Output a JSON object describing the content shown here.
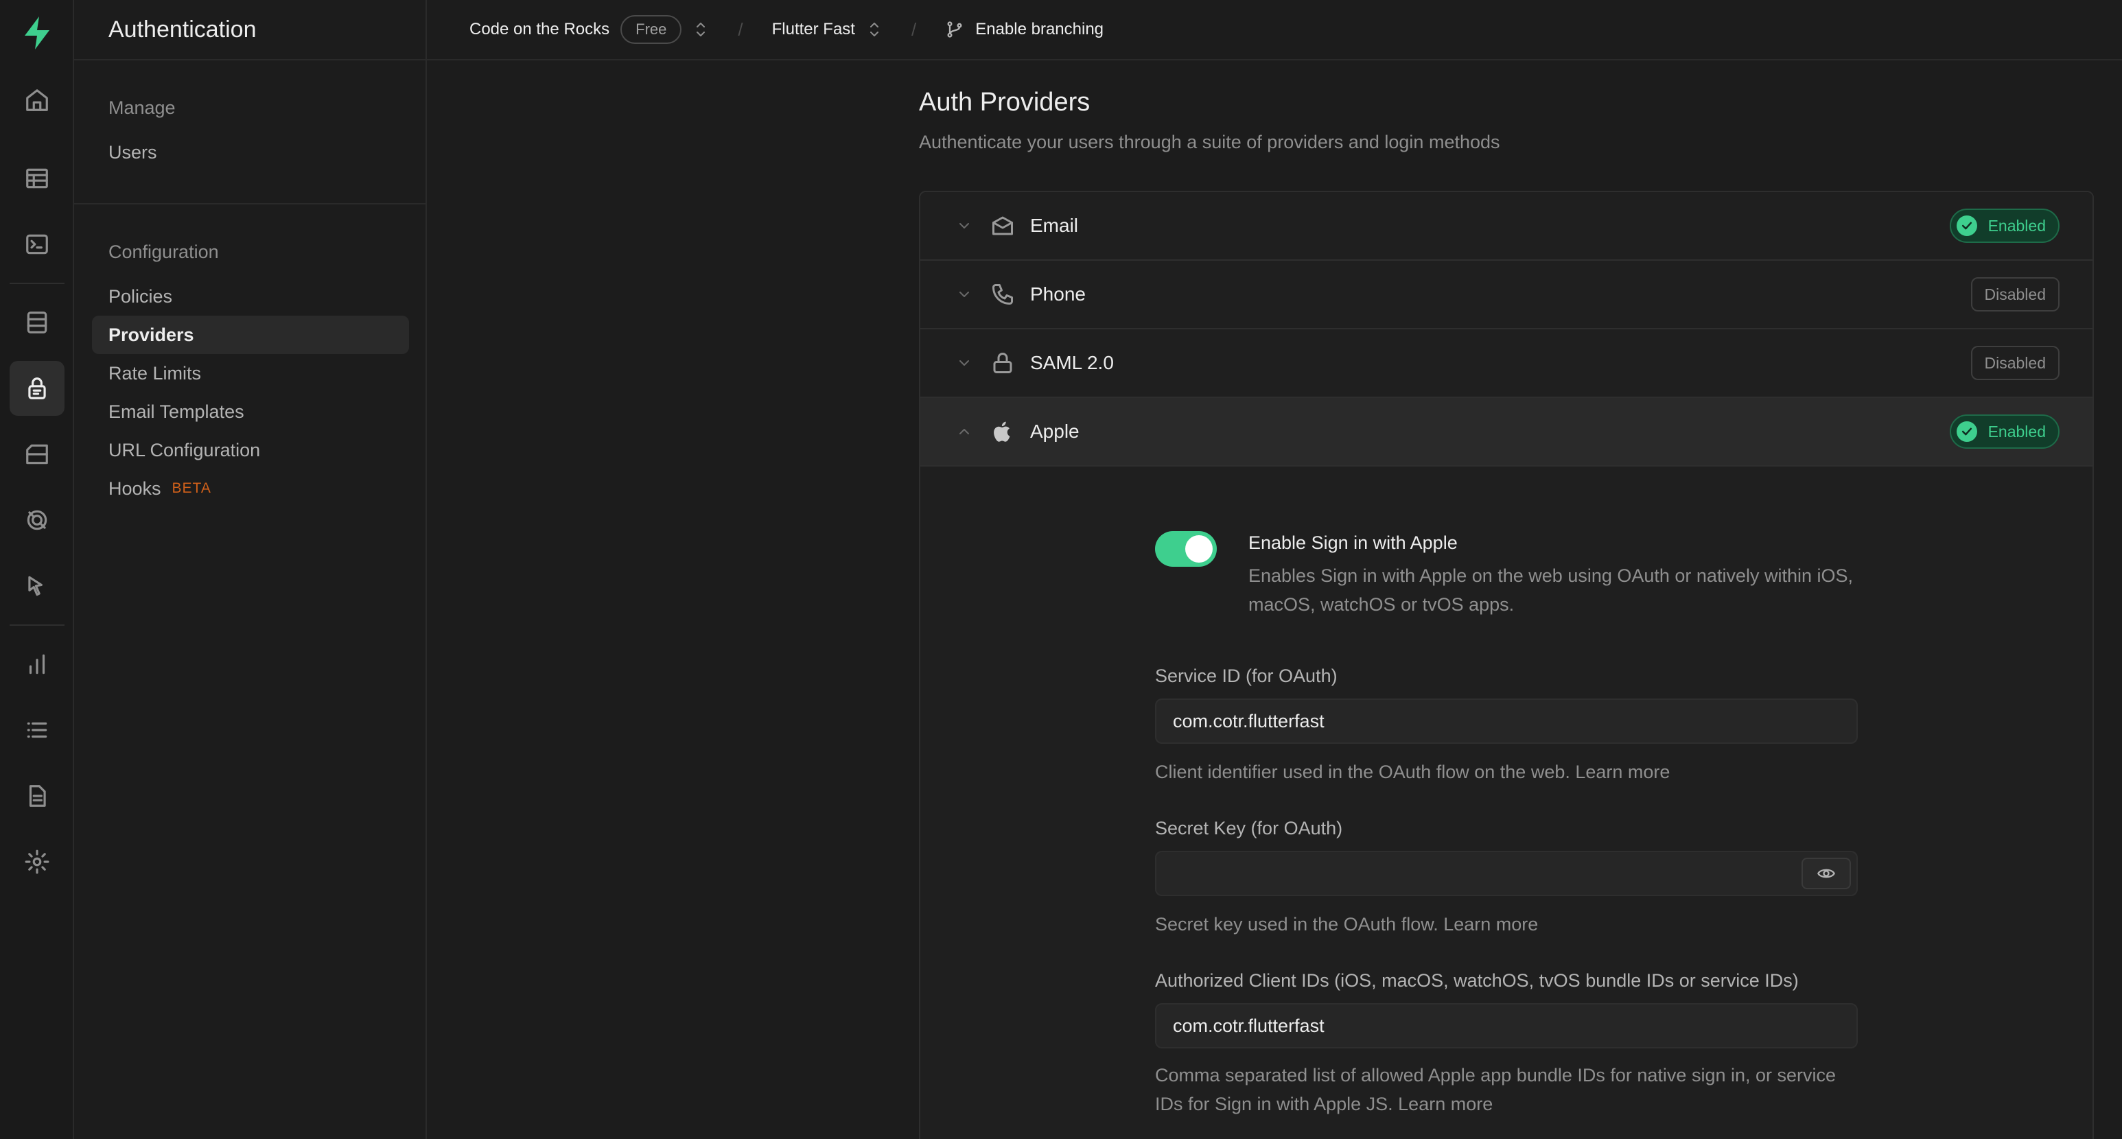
{
  "sidebar": {
    "title": "Authentication",
    "groups": [
      {
        "title": "Manage",
        "items": [
          {
            "label": "Users"
          }
        ]
      },
      {
        "title": "Configuration",
        "items": [
          {
            "label": "Policies"
          },
          {
            "label": "Providers"
          },
          {
            "label": "Rate Limits"
          },
          {
            "label": "Email Templates"
          },
          {
            "label": "URL Configuration"
          },
          {
            "label": "Hooks",
            "badge": "BETA"
          }
        ]
      }
    ]
  },
  "topbar": {
    "org": "Code on the Rocks",
    "plan": "Free",
    "project": "Flutter Fast",
    "branching": "Enable branching"
  },
  "page": {
    "title": "Auth Providers",
    "subtitle": "Authenticate your users through a suite of providers and login methods"
  },
  "providers": [
    {
      "name": "Email",
      "status": "Enabled",
      "icon": "envelope-icon"
    },
    {
      "name": "Phone",
      "status": "Disabled",
      "icon": "phone-icon"
    },
    {
      "name": "SAML 2.0",
      "status": "Disabled",
      "icon": "lock-icon"
    },
    {
      "name": "Apple",
      "status": "Enabled",
      "icon": "apple-icon"
    }
  ],
  "apple": {
    "enable_title": "Enable Sign in with Apple",
    "enable_desc": "Enables Sign in with Apple on the web using OAuth or natively within iOS, macOS, watchOS or tvOS apps.",
    "enabled": true,
    "service_id": {
      "label": "Service ID (for OAuth)",
      "value": "com.cotr.flutterfast",
      "help": "Client identifier used in the OAuth flow on the web. Learn more"
    },
    "secret_key": {
      "label": "Secret Key (for OAuth)",
      "value": "",
      "help": "Secret key used in the OAuth flow. Learn more"
    },
    "client_ids": {
      "label": "Authorized Client IDs (iOS, macOS, watchOS, tvOS bundle IDs or service IDs)",
      "value": "com.cotr.flutterfast",
      "help": "Comma separated list of allowed Apple app bundle IDs for native sign in, or service IDs for Sign in with Apple JS. Learn more"
    }
  },
  "colors": {
    "accent": "#3ecf8e",
    "background": "#1c1c1c",
    "beta": "#d0601a"
  }
}
